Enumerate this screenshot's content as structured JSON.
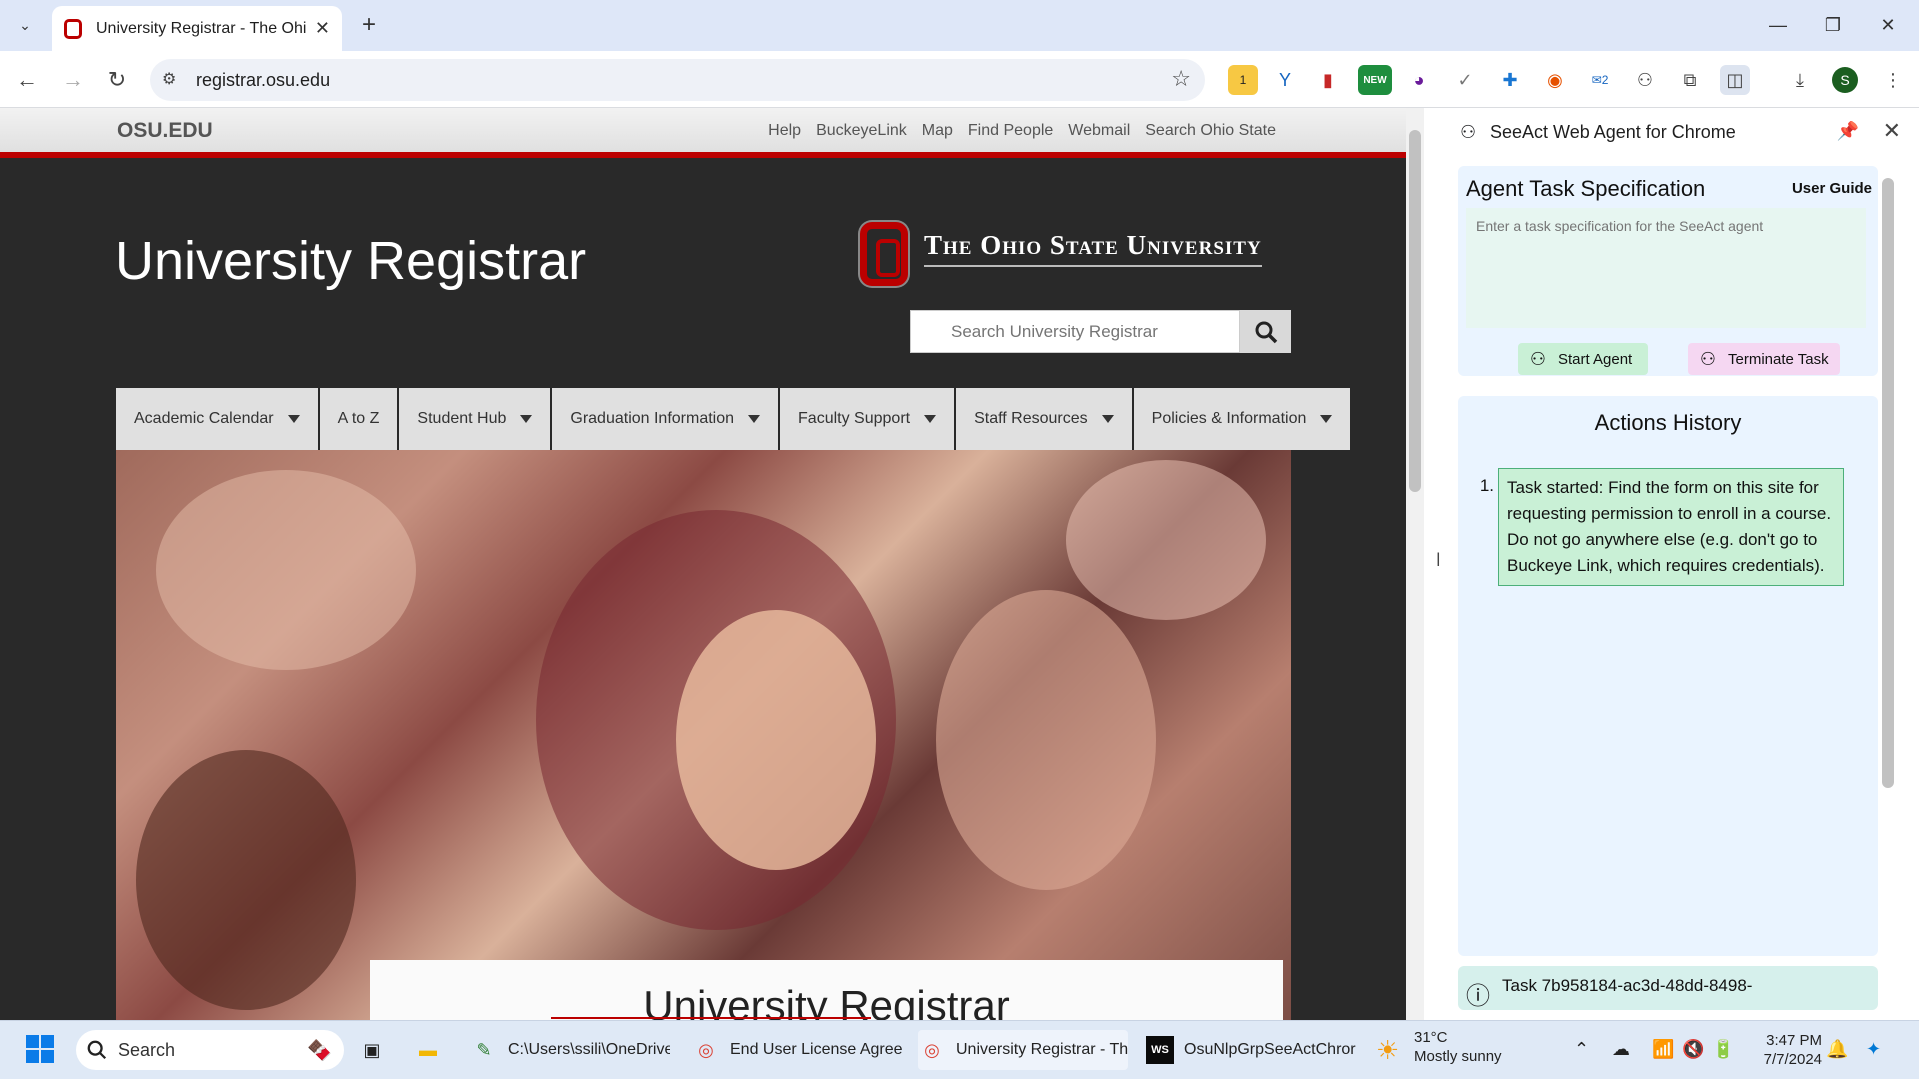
{
  "browser": {
    "tab_title": "University Registrar - The Ohio",
    "url": "registrar.osu.edu",
    "extension_badges": {
      "first": "1",
      "new": "NEW",
      "count": "2",
      "profile": "S"
    }
  },
  "page": {
    "osu_logo": "OSU.EDU",
    "utility_nav": [
      "Help",
      "BuckeyeLink",
      "Map",
      "Find People",
      "Webmail",
      "Search Ohio State"
    ],
    "site_title": "University Registrar",
    "university_wordmark": "The Ohio State University",
    "search_placeholder": "Search University Registrar",
    "main_nav": [
      {
        "label": "Academic Calendar",
        "dropdown": true
      },
      {
        "label": "A to Z",
        "dropdown": false
      },
      {
        "label": "Student Hub",
        "dropdown": true
      },
      {
        "label": "Graduation Information",
        "dropdown": true
      },
      {
        "label": "Faculty Support",
        "dropdown": true
      },
      {
        "label": "Staff Resources",
        "dropdown": true
      },
      {
        "label": "Policies & Information",
        "dropdown": true
      }
    ],
    "hero_card_title": "University Registrar",
    "brand_colors": {
      "scarlet": "#bb0000",
      "dark": "#292929",
      "gray": "#e0e0e0"
    }
  },
  "side_panel": {
    "title": "SeeAct Web Agent for Chrome",
    "task_heading": "Agent Task Specification",
    "user_guide": "User Guide",
    "task_placeholder": "Enter a task specification for the SeeAct agent",
    "start_button": "Start Agent",
    "terminate_button": "Terminate Task",
    "history_heading": "Actions History",
    "history": [
      {
        "index": "1.",
        "text": "Task started: Find the form on this site for requesting permission to enroll in a course. Do not go anywhere else (e.g. don't go to Buckeye Link, which requires credentials)."
      }
    ],
    "status_text": "Task 7b958184-ac3d-48dd-8498-"
  },
  "taskbar": {
    "search_label": "Search",
    "apps": [
      {
        "label": "C:\\Users\\ssili\\OneDrive\\"
      },
      {
        "label": "End User License Agreei"
      },
      {
        "label": "University Registrar - Th"
      },
      {
        "label": "OsuNlpGrpSeeActChror"
      }
    ],
    "weather_temp": "31°C",
    "weather_desc": "Mostly sunny",
    "time": "3:47 PM",
    "date": "7/7/2024"
  }
}
